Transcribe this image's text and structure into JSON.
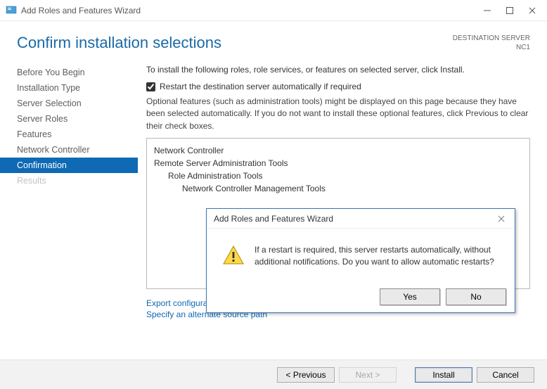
{
  "titlebar": {
    "title": "Add Roles and Features Wizard"
  },
  "header": {
    "heading": "Confirm installation selections",
    "dest_label": "DESTINATION SERVER",
    "dest_value": "NC1"
  },
  "sidebar": {
    "items": [
      {
        "label": "Before You Begin",
        "state": "normal"
      },
      {
        "label": "Installation Type",
        "state": "normal"
      },
      {
        "label": "Server Selection",
        "state": "normal"
      },
      {
        "label": "Server Roles",
        "state": "normal"
      },
      {
        "label": "Features",
        "state": "normal"
      },
      {
        "label": "Network Controller",
        "state": "normal"
      },
      {
        "label": "Confirmation",
        "state": "selected"
      },
      {
        "label": "Results",
        "state": "disabled"
      }
    ]
  },
  "main": {
    "intro": "To install the following roles, role services, or features on selected server, click Install.",
    "checkbox_label": "Restart the destination server automatically if required",
    "checkbox_checked": true,
    "optional_note": "Optional features (such as administration tools) might be displayed on this page because they have been selected automatically. If you do not want to install these optional features, click Previous to clear their check boxes.",
    "list": {
      "l1a": "Network Controller",
      "l1b": "Remote Server Administration Tools",
      "l2a": "Role Administration Tools",
      "l3a": "Network Controller Management Tools"
    },
    "links": {
      "export": "Export configuration settings",
      "altpath": "Specify an alternate source path"
    }
  },
  "footer": {
    "previous": "< Previous",
    "next": "Next >",
    "install": "Install",
    "cancel": "Cancel"
  },
  "dialog": {
    "title": "Add Roles and Features Wizard",
    "message": "If a restart is required, this server restarts automatically, without additional notifications. Do you want to allow automatic restarts?",
    "yes": "Yes",
    "no": "No"
  }
}
